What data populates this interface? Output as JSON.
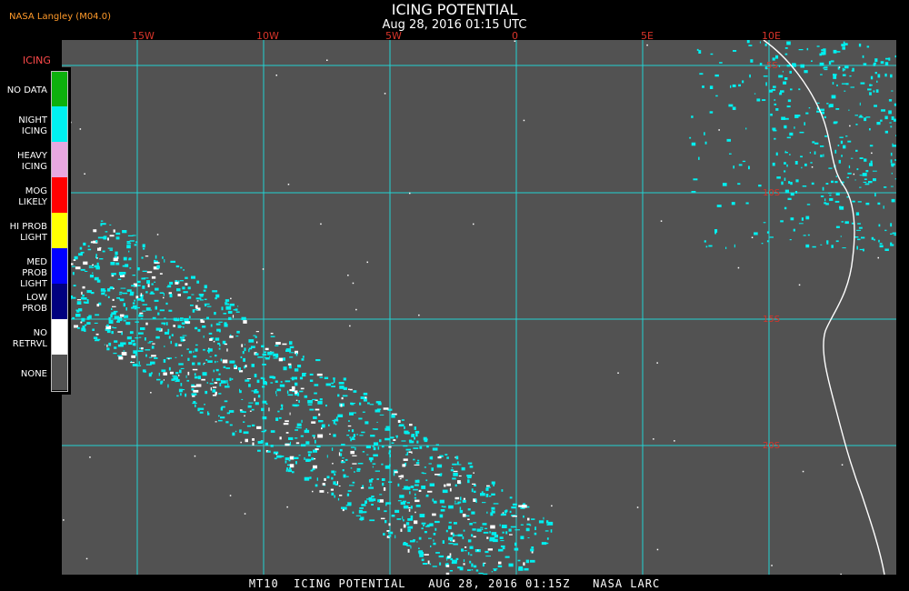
{
  "header": {
    "credit": "NASA Langley (M04.0)",
    "title": "ICING POTENTIAL",
    "subtitle": "Aug 28, 2016 01:15 UTC"
  },
  "map": {
    "lon_labels": [
      "15W",
      "10W",
      "5W",
      "0",
      "5E",
      "10E"
    ],
    "lat_labels": [
      "5S",
      "10S",
      "15S",
      "20S"
    ],
    "background_color": "#525252",
    "grid_color": "#22d3d3"
  },
  "legend": {
    "title": "ICING",
    "items": [
      {
        "label": "NO DATA",
        "color": "#0db00d"
      },
      {
        "label": "NIGHT ICING",
        "color": "#00f0f0"
      },
      {
        "label": "HEAVY ICING",
        "color": "#e8a8e0"
      },
      {
        "label": "MOG LIKELY",
        "color": "#ff0000"
      },
      {
        "label": "HI PROB LIGHT",
        "color": "#ffff00"
      },
      {
        "label": "MED PROB LIGHT",
        "color": "#0000ff"
      },
      {
        "label": "LOW PROB",
        "color": "#00007f"
      },
      {
        "label": "NO RETRVL",
        "color": "#ffffff"
      },
      {
        "label": "NONE",
        "color": "#525252"
      }
    ]
  },
  "footer": {
    "text": "MT10  ICING POTENTIAL   AUG 28, 2016 01:15Z   NASA LARC"
  }
}
